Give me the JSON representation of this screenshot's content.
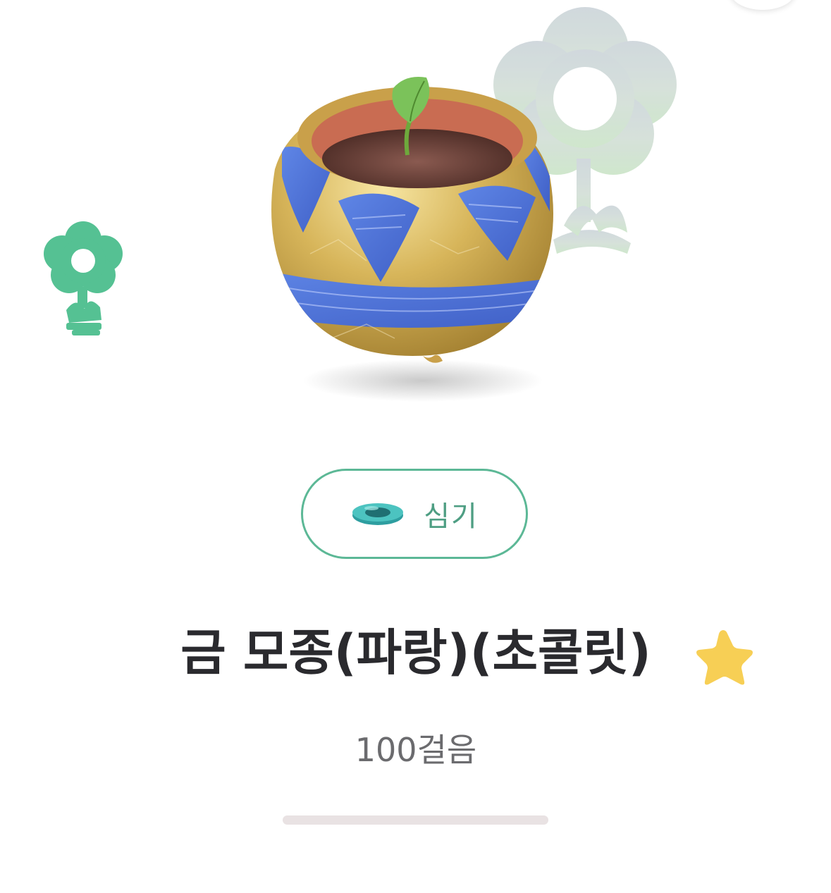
{
  "item": {
    "name": "금 모종(파랑)(초콜릿)",
    "cost": "100걸음",
    "favorite": true
  },
  "actions": {
    "plant_label": "심기"
  },
  "progress": {
    "fraction": 0
  },
  "icons": {
    "plant_button_icon": "planter-dish-icon",
    "favorite_icon": "star-icon",
    "pot_image": "gold-blue-pot-with-sprout",
    "background_flower": "flower-balloon-icon"
  },
  "colors": {
    "accent": "#5cb896",
    "accent_text": "#4e9e83",
    "title": "#2a2a2e",
    "star": "#f7cf55",
    "cost_text": "#6b6b6e",
    "track": "#e9e2e3"
  }
}
